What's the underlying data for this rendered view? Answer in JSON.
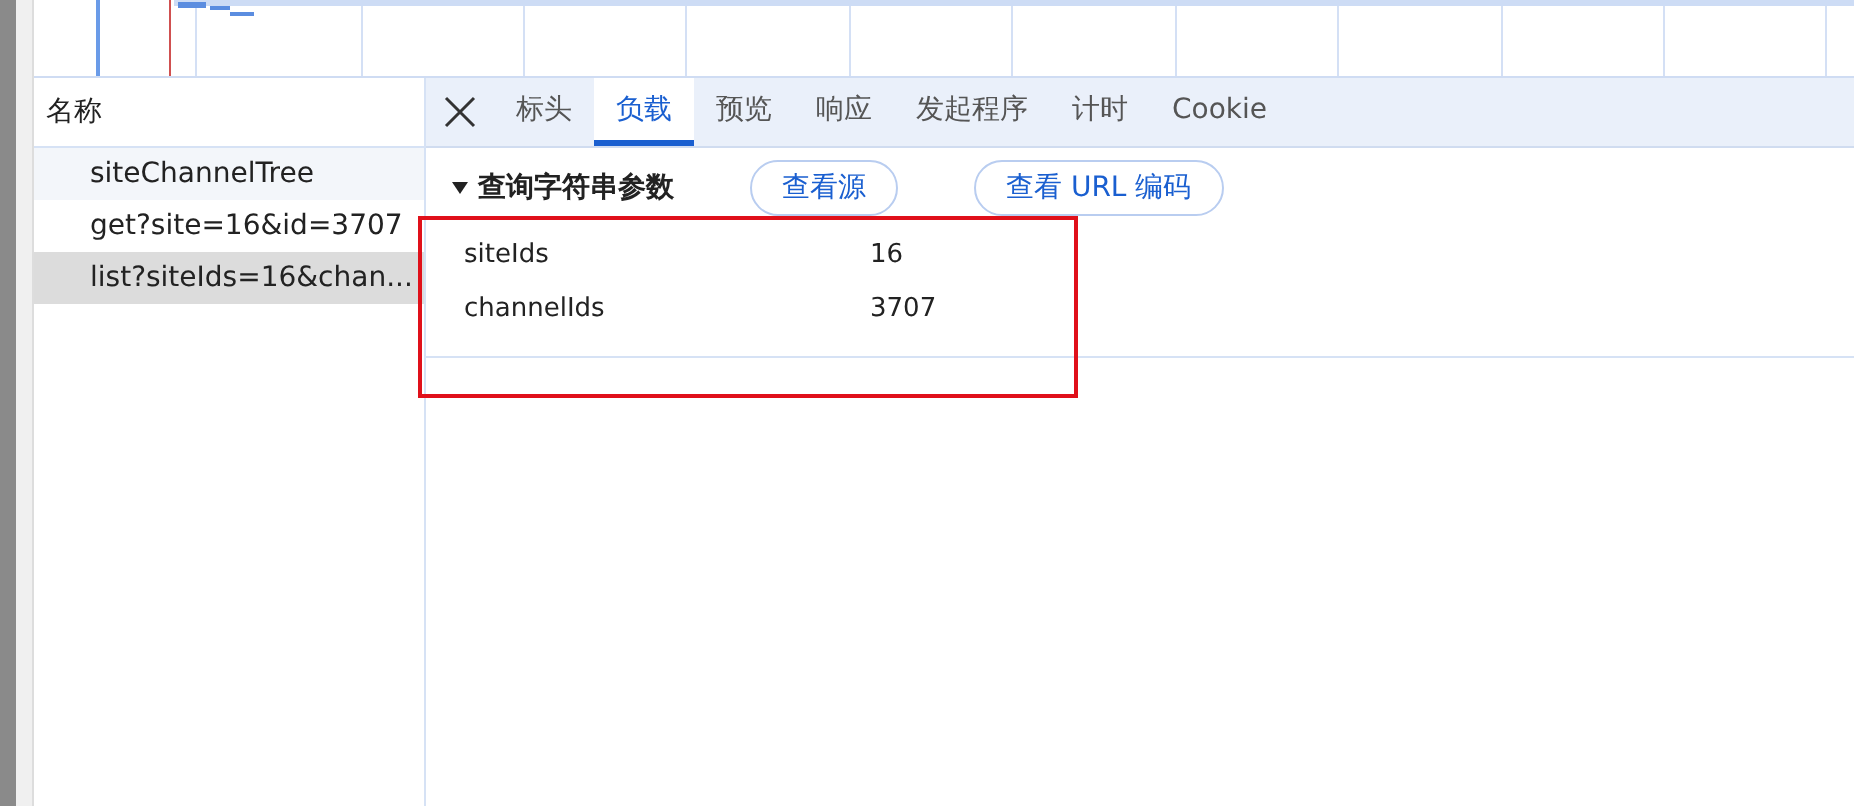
{
  "requests": {
    "header": "名称",
    "items": [
      {
        "name": "siteChannelTree",
        "selected": false
      },
      {
        "name": "get?site=16&id=3707",
        "selected": false
      },
      {
        "name": "list?siteIds=16&chan...",
        "selected": true
      }
    ]
  },
  "detail": {
    "tabs": [
      {
        "label": "标头",
        "selected": false
      },
      {
        "label": "负载",
        "selected": true
      },
      {
        "label": "预览",
        "selected": false
      },
      {
        "label": "响应",
        "selected": false
      },
      {
        "label": "发起程序",
        "selected": false
      },
      {
        "label": "计时",
        "selected": false
      },
      {
        "label": "Cookie",
        "selected": false
      }
    ],
    "section": {
      "title": "查询字符串参数",
      "expanded": true,
      "buttons": [
        "查看源",
        "查看 URL 编码"
      ],
      "params": [
        {
          "key": "siteIds",
          "value": "16"
        },
        {
          "key": "channelIds",
          "value": "3707"
        }
      ]
    }
  }
}
